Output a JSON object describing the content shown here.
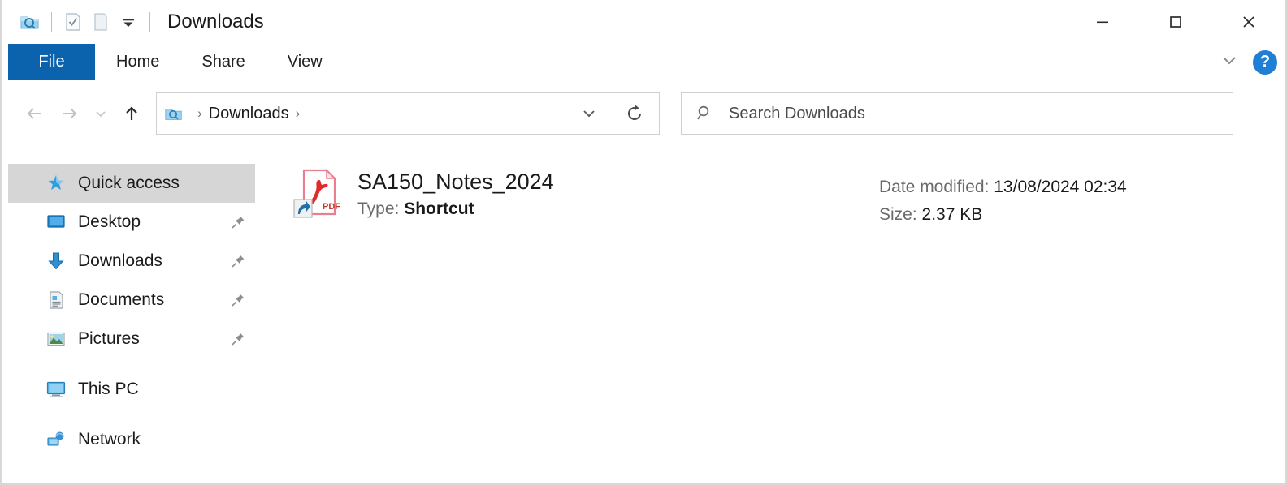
{
  "window": {
    "title": "Downloads",
    "quick_access_toolbar": [
      {
        "name": "explorer-icon",
        "label": "File Explorer"
      },
      {
        "name": "properties-icon",
        "label": "Properties"
      },
      {
        "name": "new-folder-icon",
        "label": "New folder"
      },
      {
        "name": "customize-chevron-icon",
        "label": "Customize Quick Access Toolbar"
      }
    ],
    "controls": {
      "minimize": "–",
      "maximize": "□",
      "close": "✕"
    }
  },
  "ribbon": {
    "tabs": [
      {
        "label": "File",
        "active": true
      },
      {
        "label": "Home",
        "active": false
      },
      {
        "label": "Share",
        "active": false
      },
      {
        "label": "View",
        "active": false
      }
    ],
    "collapse_label": "⌄",
    "help_label": "?"
  },
  "navbar": {
    "back_label": "←",
    "forward_label": "→",
    "recent_label": "⌄",
    "up_label": "↑",
    "breadcrumb": [
      "Downloads"
    ],
    "breadcrumb_separator": "›",
    "dropdown_label": "⌄",
    "refresh_label": "↻"
  },
  "search": {
    "placeholder": "Search Downloads",
    "value": ""
  },
  "sidebar": {
    "items": [
      {
        "label": "Quick access",
        "icon": "star-pin-icon",
        "selected": true,
        "pinned": false,
        "indent": false
      },
      {
        "label": "Desktop",
        "icon": "desktop-icon",
        "selected": false,
        "pinned": true,
        "indent": true
      },
      {
        "label": "Downloads",
        "icon": "download-arrow-icon",
        "selected": false,
        "pinned": true,
        "indent": true
      },
      {
        "label": "Documents",
        "icon": "documents-icon",
        "selected": false,
        "pinned": true,
        "indent": true
      },
      {
        "label": "Pictures",
        "icon": "pictures-icon",
        "selected": false,
        "pinned": true,
        "indent": true
      },
      {
        "label": "This PC",
        "icon": "this-pc-icon",
        "selected": false,
        "pinned": false,
        "indent": false
      },
      {
        "label": "Network",
        "icon": "network-icon",
        "selected": false,
        "pinned": false,
        "indent": false
      }
    ]
  },
  "file_list": {
    "items": [
      {
        "name": "SA150_Notes_2024",
        "type_label": "Type:",
        "type_value": "Shortcut",
        "date_label": "Date modified:",
        "date_value": "13/08/2024 02:34",
        "size_label": "Size:",
        "size_value": "2.37 KB",
        "icon": "pdf-shortcut-icon"
      }
    ]
  },
  "colors": {
    "accent": "#0b62ad",
    "selection": "#d6d6d6",
    "help_blue": "#1f7fd4",
    "pdf_red": "#e02b2b"
  }
}
